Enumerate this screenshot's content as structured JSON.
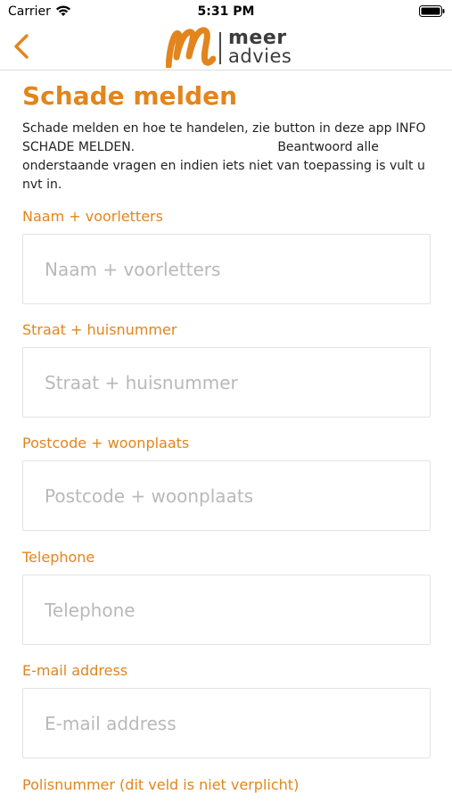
{
  "status_bar": {
    "carrier": "Carrier",
    "time": "5:31 PM",
    "icons": [
      "wifi-icon",
      "battery-icon"
    ]
  },
  "nav": {
    "back_icon": "chevron-left-icon",
    "logo_line1": "meer",
    "logo_line2": "advies"
  },
  "page": {
    "title": "Schade melden",
    "intro": "Schade melden en hoe te handelen, zie button in deze app INFO SCHADE MELDEN.                                    Beantwoord alle onderstaande vragen en indien iets niet van toepassing is vult u nvt in."
  },
  "form": {
    "fields": [
      {
        "label": "Naam + voorletters",
        "placeholder": "Naam + voorletters",
        "value": ""
      },
      {
        "label": "Straat + huisnummer",
        "placeholder": "Straat + huisnummer",
        "value": ""
      },
      {
        "label": "Postcode + woonplaats",
        "placeholder": "Postcode + woonplaats",
        "value": ""
      },
      {
        "label": "Telephone",
        "placeholder": "Telephone",
        "value": ""
      },
      {
        "label": "E-mail address",
        "placeholder": "E-mail address",
        "value": ""
      },
      {
        "label": "Polisnummer (dit veld is niet verplicht)",
        "placeholder": "",
        "value": ""
      }
    ]
  },
  "colors": {
    "accent": "#e2851d",
    "label": "#e2851d",
    "placeholder": "#b9b9b9",
    "border": "#e3e3e3"
  }
}
